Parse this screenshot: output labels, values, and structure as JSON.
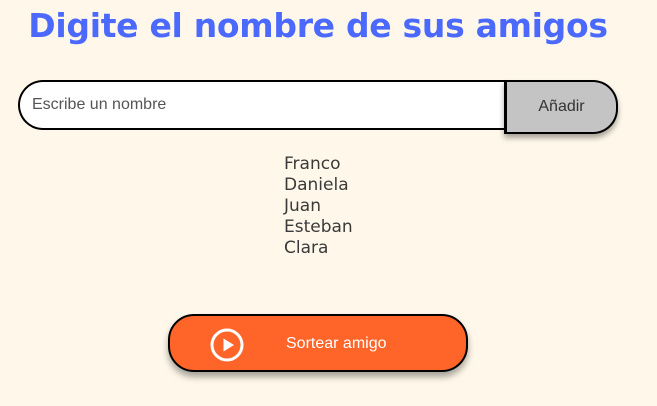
{
  "header": {
    "title": "Digite el nombre de sus amigos"
  },
  "input": {
    "placeholder": "Escribe un nombre",
    "value": ""
  },
  "add_button": {
    "label": "Añadir"
  },
  "friends": [
    "Franco",
    "Daniela",
    "Juan",
    "Esteban",
    "Clara"
  ],
  "draw_button": {
    "label": "Sortear amigo",
    "icon": "play-circle-icon"
  },
  "colors": {
    "background": "#fff8ea",
    "title": "#4b69fd",
    "draw_button": "#ff6428",
    "add_button": "#c4c4c4"
  }
}
